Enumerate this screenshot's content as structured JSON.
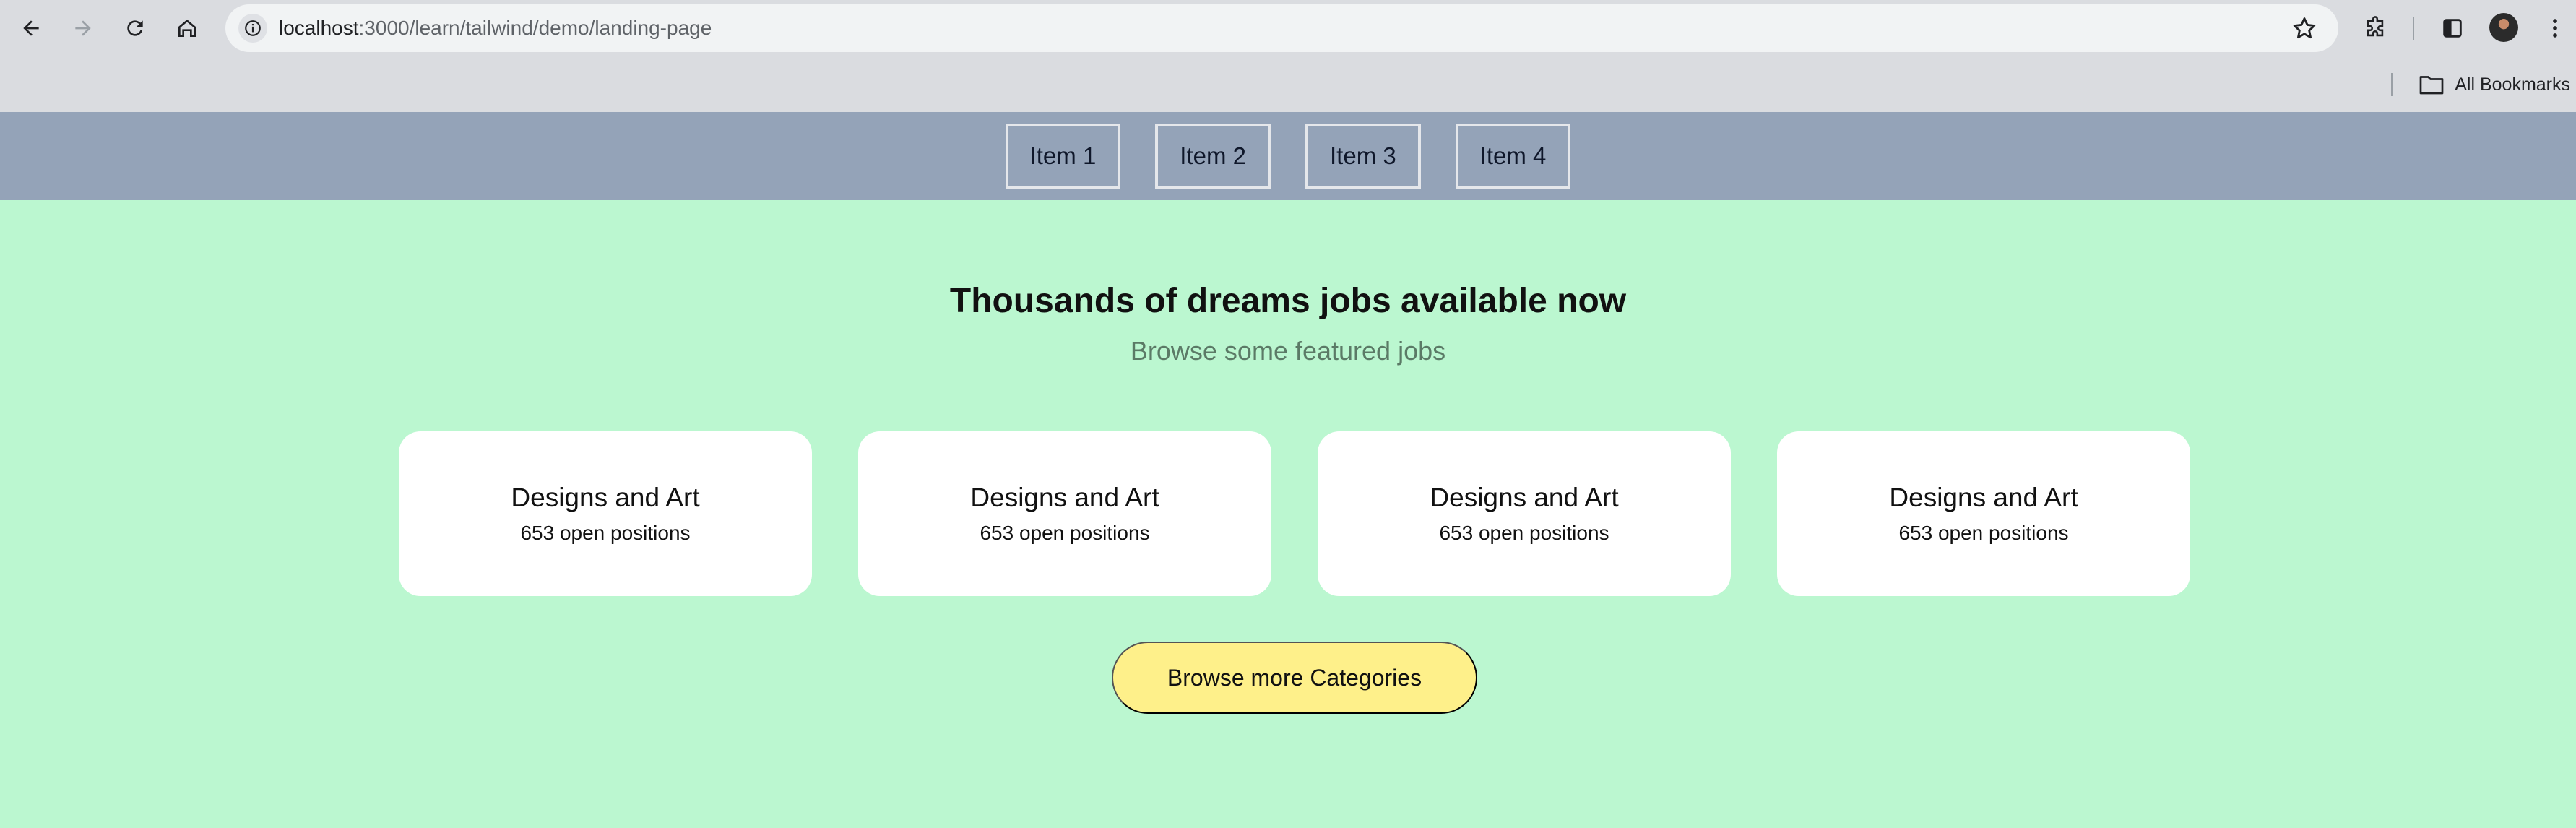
{
  "browser": {
    "url_host": "localhost",
    "url_path": ":3000/learn/tailwind/demo/landing-page",
    "bookmarks_label": "All Bookmarks"
  },
  "nav": {
    "items": [
      {
        "label": "Item 1"
      },
      {
        "label": "Item 2"
      },
      {
        "label": "Item 3"
      },
      {
        "label": "Item 4"
      }
    ]
  },
  "hero": {
    "title": "Thousands of dreams jobs available now",
    "subtitle": "Browse some featured jobs"
  },
  "cards": [
    {
      "title": "Designs and Art",
      "subtitle": "653 open positions"
    },
    {
      "title": "Designs and Art",
      "subtitle": "653 open positions"
    },
    {
      "title": "Designs and Art",
      "subtitle": "653 open positions"
    },
    {
      "title": "Designs and Art",
      "subtitle": "653 open positions"
    }
  ],
  "cta": {
    "label": "Browse more Categories"
  },
  "colors": {
    "nav_bg": "#94a3b8",
    "page_bg": "#bbf7d0",
    "card_bg": "#ffffff",
    "button_bg": "#fef08a"
  }
}
